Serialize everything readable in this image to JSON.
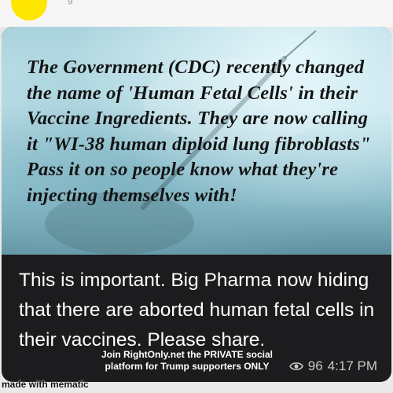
{
  "meme": {
    "text": "The Government (CDC) recently changed the name of 'Human Fetal Cells' in their Vaccine Ingredients. They are now calling it \"WI-38 human diploid lung fibroblasts\" Pass it on so people know what they're injecting themselves with!"
  },
  "post": {
    "caption": "This is important. Big Pharma now hiding that there are aborted human fetal cells in their vaccines. Please share.",
    "promo": "Join RightOnly.net the PRIVATE social platform for Trump supporters ONLY",
    "views": "96",
    "time": "4:17 PM"
  },
  "watermark": "made with mematic",
  "colors": {
    "avatar": "#ffe600",
    "bubble": "#1c1c1e",
    "caption_text": "#ffffff",
    "meta_text": "#c8c8c8"
  },
  "icons": {
    "views": "eye-icon"
  }
}
